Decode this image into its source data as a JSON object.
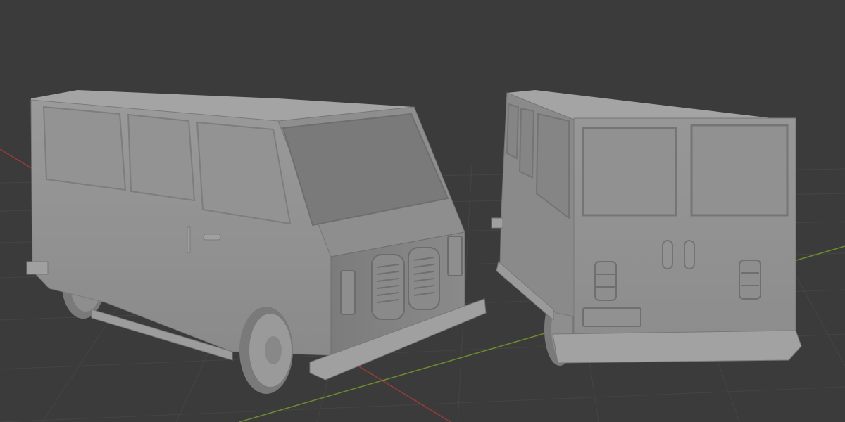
{
  "scene": {
    "background_color": "#3b3b3b",
    "grid_color": "#454545",
    "x_axis_color": "#9a3a3a",
    "y_axis_color": "#6d8a2f",
    "model_color": "#8c8c8c",
    "models": [
      {
        "name": "van-front-three-quarter"
      },
      {
        "name": "van-rear-three-quarter"
      }
    ]
  }
}
